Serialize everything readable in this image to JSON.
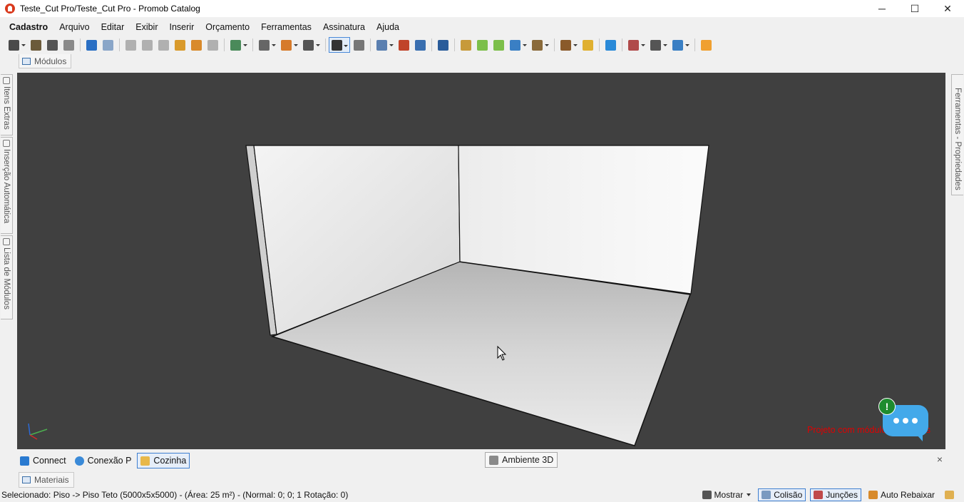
{
  "window": {
    "title": "Teste_Cut Pro/Teste_Cut Pro - Promob Catalog",
    "minimize": "─",
    "maximize": "☐",
    "close": "✕"
  },
  "menu": [
    "Cadastro",
    "Arquivo",
    "Editar",
    "Exibir",
    "Inserir",
    "Orçamento",
    "Ferramentas",
    "Assinatura",
    "Ajuda"
  ],
  "toolbar_icons": [
    {
      "name": "save-icon",
      "color": "#4a4a4a",
      "dropdown": true
    },
    {
      "name": "print-setup-icon",
      "color": "#6b5a3a"
    },
    {
      "name": "print-preview-icon",
      "color": "#555555"
    },
    {
      "name": "print-icon",
      "color": "#8a8a8a"
    },
    {
      "name": "undo-icon",
      "color": "#2a6fc4"
    },
    {
      "name": "redo-icon",
      "color": "#8aa6c8"
    },
    {
      "name": "cut-icon",
      "color": "#b0b0b0"
    },
    {
      "name": "copy-icon",
      "color": "#b0b0b0"
    },
    {
      "name": "paste-icon",
      "color": "#b0b0b0"
    },
    {
      "name": "pick-properties-icon",
      "color": "#d99a2b"
    },
    {
      "name": "paint-icon",
      "color": "#d98a2b"
    },
    {
      "name": "delete-icon",
      "color": "#b0b0b0"
    },
    {
      "name": "render-icon",
      "color": "#4a8a5a",
      "dropdown": true
    },
    {
      "name": "group-icon",
      "color": "#666666",
      "dropdown": true
    },
    {
      "name": "align-icon",
      "color": "#d67a2a",
      "dropdown": true
    },
    {
      "name": "lasso-icon",
      "color": "#555555",
      "dropdown": true
    },
    {
      "name": "select-pointer-icon",
      "color": "#333333",
      "dropdown": true,
      "active": true
    },
    {
      "name": "measure-icon",
      "color": "#777777"
    },
    {
      "name": "layers-icon",
      "color": "#5a7fb0",
      "dropdown": true
    },
    {
      "name": "dimension-icon",
      "color": "#c0442a"
    },
    {
      "name": "view-3d-icon",
      "color": "#3a6fb0"
    },
    {
      "name": "eye-icon",
      "color": "#2a5c9a"
    },
    {
      "name": "import-icon",
      "color": "#c79a3a"
    },
    {
      "name": "back-arrow-icon",
      "color": "#7cbf4a"
    },
    {
      "name": "forward-arrow-icon",
      "color": "#7cbf4a"
    },
    {
      "name": "cube-view-icon",
      "color": "#3a7fc4",
      "dropdown": true
    },
    {
      "name": "box-icon",
      "color": "#8a6a3a",
      "dropdown": true
    },
    {
      "name": "lamp-icon",
      "color": "#8a5a2a",
      "dropdown": true
    },
    {
      "name": "light-bulb-icon",
      "color": "#e0b030"
    },
    {
      "name": "chat-icon",
      "color": "#2a8ad8"
    },
    {
      "name": "report-icon",
      "color": "#b04a4a",
      "dropdown": true
    },
    {
      "name": "layout-icon",
      "color": "#555555",
      "dropdown": true
    },
    {
      "name": "factory-icon",
      "color": "#3a7fc4",
      "dropdown": true
    },
    {
      "name": "user-icon",
      "color": "#f0a030"
    }
  ],
  "tabs": {
    "modulos": "Módulos",
    "materiais": "Materiais"
  },
  "left_panels": [
    "Itens Extras",
    "Inserção Automática",
    "Lista de Módulos"
  ],
  "right_panels": [
    "Ferramentas - Propriedades"
  ],
  "viewport": {
    "background": "#404040",
    "warning": "Projeto com módulos especiais",
    "chat_badge": "!"
  },
  "bottom_tabs": [
    {
      "label": "Connect",
      "icon": "rss-icon",
      "color": "#2a7ad0"
    },
    {
      "label": "Conexão P",
      "icon": "globe-icon",
      "color": "#3a8ad8"
    },
    {
      "label": "Cozinha",
      "icon": "folder-icon",
      "color": "#e8b84a",
      "selected": true
    }
  ],
  "viewport_tab": "Ambiente 3D",
  "viewport_tab_close": "×",
  "status": {
    "text": "Selecionado: Piso -> Piso Teto (5000x5x5000) - (Área: 25 m²) - (Normal: 0; 0; 1 Rotação: 0)",
    "mostrar": "Mostrar",
    "colisao": "Colisão",
    "juncoes": "Junções",
    "auto_rebaixar": "Auto Rebaixar"
  }
}
